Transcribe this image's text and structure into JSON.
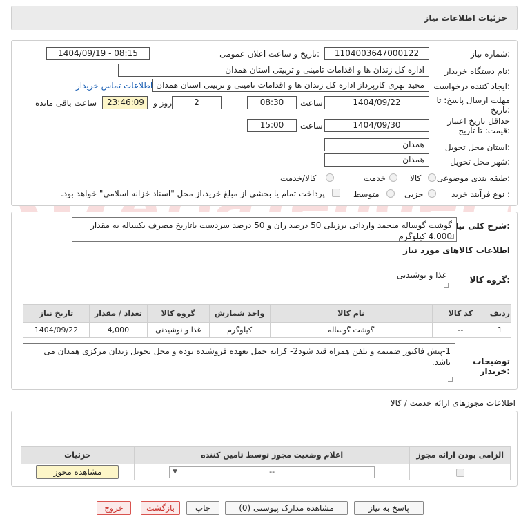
{
  "header": {
    "title": "جزئیات اطلاعات نیاز"
  },
  "info": {
    "need_number_label": "شماره نیاز:",
    "need_number": "1104003647000122",
    "announce_label": "تاریخ و ساعت اعلان عمومی:",
    "announce_value": "1404/09/19 - 08:15",
    "buyer_label": "نام دستگاه خریدار:",
    "buyer_value": "اداره کل زندان ها و اقدامات تامینی و تربیتی استان همدان",
    "requester_label": "ایجاد کننده درخواست:",
    "requester_value": "مجید بهری کارپرداز اداره کل زندان ها و اقدامات تامینی و تربیتی استان همدان",
    "contact_link": "اطلاعات تماس خریدار",
    "deadline_label_1": "مهلت ارسال پاسخ: تا",
    "deadline_label_2": "تاریخ:",
    "deadline_date": "1404/09/22",
    "time_label": "ساعت",
    "deadline_time": "08:30",
    "days_value": "2",
    "days_label": "روز و",
    "remaining_value": "23:46:09",
    "remaining_label": "ساعت باقی مانده",
    "validity_label_1": "حداقل تاریخ اعتبار",
    "validity_label_2": "قیمت: تا تاریخ:",
    "validity_date": "1404/09/30",
    "validity_time": "15:00",
    "province_label": "استان محل تحویل:",
    "province_value": "همدان",
    "city_label": "شهر محل تحویل:",
    "city_value": "همدان",
    "category_label": "طبقه بندی موضوعی:",
    "category_options": [
      "کالا",
      "خدمت",
      "کالا/خدمت"
    ],
    "process_label": "نوع فرآیند خرید :",
    "process_options": [
      "جزیی",
      "متوسط"
    ],
    "payment_note": "پرداخت تمام یا بخشی از مبلغ خرید،از محل \"اسناد خزانه اسلامی\" خواهد بود."
  },
  "summary": {
    "label": "شرح کلی نیاز:",
    "text": "گوشت گوساله منجمد وارداتی برزیلی 50 درصد ران و 50 درصد سردست باتاریخ مصرف یکساله به مقدار 4.000 کیلوگرم"
  },
  "goods": {
    "section_title": "اطلاعات کالاهای مورد نیاز",
    "group_label": "گروه کالا:",
    "group_value": "غذا و نوشیدنی",
    "columns": [
      "ردیف",
      "کد کالا",
      "نام کالا",
      "واحد شمارش",
      "گروه کالا",
      "تعداد / مقدار",
      "تاریخ نیاز"
    ],
    "rows": [
      [
        "1",
        "--",
        "گوشت گوساله",
        "کیلوگرم",
        "غذا و نوشیدنی",
        "4,000",
        "1404/09/22"
      ]
    ]
  },
  "buyer_notes": {
    "label_1": "توضیحات",
    "label_2": "خریدار:",
    "text": "1-پیش فاکتور ضمیمه و تلفن همراه قید شود2- کرایه حمل بعهده فروشنده بوده و محل تحویل زندان مرکزی همدان می باشد."
  },
  "permits": {
    "title": "اطلاعات مجوزهای ارائه خدمت / کالا",
    "columns": [
      "الزامی بودن ارائه مجوز",
      "اعلام وضعیت مجوز توسط تامین کننده",
      "جزئیات"
    ],
    "select_value": "--",
    "view_button": "مشاهده مجوز"
  },
  "actions": {
    "reply": "پاسخ به نیاز",
    "attachments": "مشاهده مدارک پیوستی (0)",
    "print": "چاپ",
    "back": "بازگشت",
    "exit": "خروج"
  },
  "colors": {
    "link": "#1a5fb4",
    "highlight": "#fdf6c8",
    "exit": "#c9302c"
  }
}
